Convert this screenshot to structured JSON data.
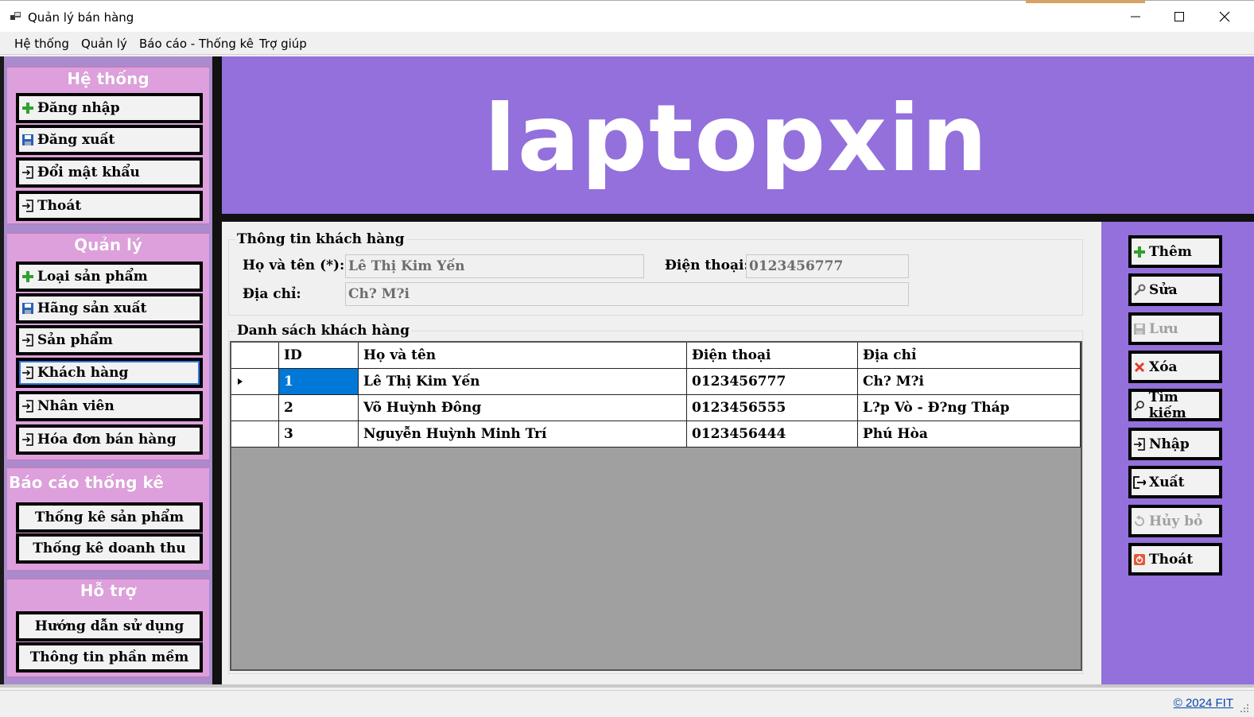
{
  "window": {
    "title": "Quản lý bán hàng",
    "icons": [
      "app-icon",
      "minimize-icon",
      "maximize-icon",
      "close-icon"
    ]
  },
  "menu": [
    "Hệ thống",
    "Quản lý",
    "Báo cáo - Thống kê",
    "Trợ giúp"
  ],
  "sidebar": {
    "system": {
      "title": "Hệ thống",
      "items": [
        {
          "label": "Đăng nhập",
          "icon": "plus-icon"
        },
        {
          "label": "Đăng xuất",
          "icon": "save-icon"
        },
        {
          "label": "Đổi mật khẩu",
          "icon": "enter-icon"
        },
        {
          "label": "Thoát",
          "icon": "enter-icon"
        }
      ]
    },
    "manage": {
      "title": "Quản lý",
      "items": [
        {
          "label": "Loại sản phẩm",
          "icon": "plus-icon"
        },
        {
          "label": "Hãng sản xuất",
          "icon": "save-icon"
        },
        {
          "label": "Sản phẩm",
          "icon": "enter-icon"
        },
        {
          "label": "Khách hàng",
          "icon": "enter-icon",
          "selected": true
        },
        {
          "label": "Nhân viên",
          "icon": "enter-icon"
        },
        {
          "label": "Hóa đơn bán hàng",
          "icon": "enter-icon"
        }
      ]
    },
    "reports": {
      "title": "Báo cáo thống kê",
      "items": [
        {
          "label": "Thống kê sản phẩm"
        },
        {
          "label": "Thống kê doanh thu"
        }
      ]
    },
    "support": {
      "title": "Hỗ trợ",
      "items": [
        {
          "label": "Hướng dẫn sử dụng"
        },
        {
          "label": "Thông tin phần mềm"
        }
      ]
    }
  },
  "banner": {
    "logo_text": "laptopxin"
  },
  "customer_info": {
    "group_title": "Thông tin khách hàng",
    "name_label": "Họ và tên (*):",
    "name_value": "Lê Thị Kim Yến",
    "phone_label": "Điện thoại:",
    "phone_value": "0123456777",
    "address_label": "Địa chỉ:",
    "address_value": "Ch? M?i"
  },
  "customer_list": {
    "group_title": "Danh sách khách hàng",
    "columns": [
      "ID",
      "Họ và tên",
      "Điện thoại",
      "Địa chỉ"
    ],
    "rows": [
      {
        "id": "1",
        "name": "Lê Thị Kim Yến",
        "phone": "0123456777",
        "address": "Ch? M?i",
        "current": true
      },
      {
        "id": "2",
        "name": "Võ Huỳnh Đông",
        "phone": "0123456555",
        "address": "L?p Vò - Đ?ng Tháp"
      },
      {
        "id": "3",
        "name": "Nguyễn Huỳnh Minh Trí",
        "phone": "0123456444",
        "address": "Phú Hòa"
      }
    ]
  },
  "actions": [
    {
      "label": "Thêm",
      "icon": "plus-icon",
      "enabled": true
    },
    {
      "label": "Sửa",
      "icon": "wrench-icon",
      "enabled": true
    },
    {
      "label": "Lưu",
      "icon": "save-icon",
      "enabled": false
    },
    {
      "label": "Xóa",
      "icon": "delete-icon",
      "enabled": true
    },
    {
      "label": "Tìm kiếm",
      "icon": "search-icon",
      "enabled": true
    },
    {
      "label": "Nhập",
      "icon": "enter-icon",
      "enabled": true
    },
    {
      "label": "Xuất",
      "icon": "exit-icon",
      "enabled": true
    },
    {
      "label": "Hủy bỏ",
      "icon": "undo-icon",
      "enabled": false
    },
    {
      "label": "Thoát",
      "icon": "power-icon",
      "enabled": true
    }
  ],
  "status": {
    "copyright": "© 2024 FIT"
  },
  "colors": {
    "sidebar_group": "#dea0dc",
    "content_bg": "#9370db",
    "selection": "#0078d7"
  }
}
